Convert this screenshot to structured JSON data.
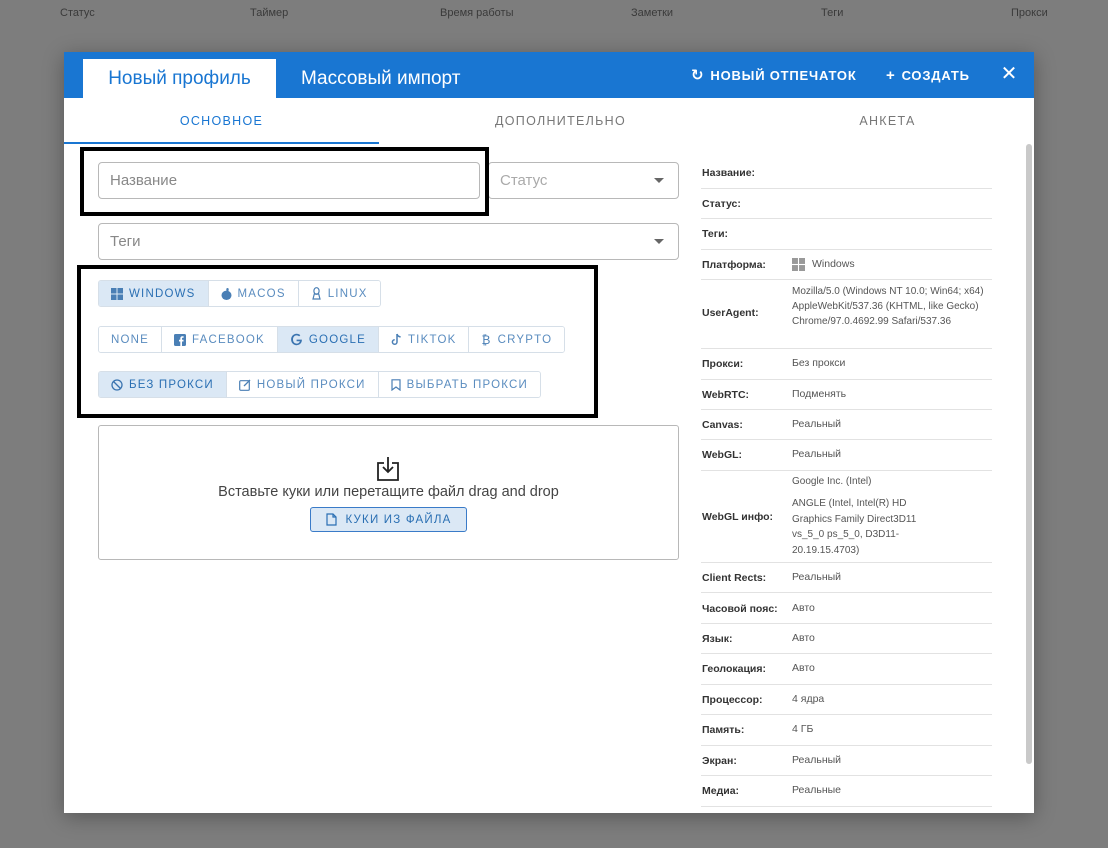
{
  "background_header": [
    "Статус",
    "Таймер",
    "Время работы",
    "Заметки",
    "Теги",
    "Прокси"
  ],
  "dialog": {
    "tabs": {
      "new_profile": "Новый профиль",
      "mass_import": "Массовый импорт"
    },
    "actions": {
      "new_fingerprint": "НОВЫЙ ОТПЕЧАТОК",
      "create": "СОЗДАТЬ"
    },
    "subtabs": {
      "main": "ОСНОВНОЕ",
      "extra": "ДОПОЛНИТЕЛЬНО",
      "form": "АНКЕТА"
    }
  },
  "form": {
    "name_placeholder": "Название",
    "status_placeholder": "Статус",
    "tags_placeholder": "Теги",
    "os_buttons": [
      "WINDOWS",
      "MACOS",
      "LINUX"
    ],
    "preset_buttons": [
      "NONE",
      "FACEBOOK",
      "GOOGLE",
      "TIKTOK",
      "CRYPTO"
    ],
    "proxy_buttons": [
      "БЕЗ ПРОКСИ",
      "НОВЫЙ ПРОКСИ",
      "ВЫБРАТЬ ПРОКСИ"
    ],
    "cookies": {
      "hint": "Вставьте куки или перетащите файл drag and drop",
      "button": "КУКИ ИЗ ФАЙЛА"
    }
  },
  "summary": {
    "name_label": "Название:",
    "status_label": "Статус:",
    "tags_label": "Теги:",
    "platform_label": "Платформа:",
    "platform_value": "Windows",
    "useragent_label": "UserAgent:",
    "useragent_value": "Mozilla/5.0 (Windows NT 10.0; Win64; x64) AppleWebKit/537.36 (KHTML, like Gecko) Chrome/97.0.4692.99 Safari/537.36",
    "proxy_label": "Прокси:",
    "proxy_value": "Без прокси",
    "webrtc_label": "WebRTC:",
    "webrtc_value": "Подменять",
    "canvas_label": "Canvas:",
    "canvas_value": "Реальный",
    "webgl_label": "WebGL:",
    "webgl_value": "Реальный",
    "webgl_info_label": "WebGL инфо:",
    "webgl_info_vendor": "Google Inc. (Intel)",
    "webgl_info_renderer": "ANGLE (Intel, Intel(R) HD Graphics Family Direct3D11 vs_5_0 ps_5_0, D3D11-20.19.15.4703)",
    "client_rects_label": "Client Rects:",
    "client_rects_value": "Реальный",
    "timezone_label": "Часовой пояс:",
    "timezone_value": "Авто",
    "language_label": "Язык:",
    "language_value": "Авто",
    "geo_label": "Геолокация:",
    "geo_value": "Авто",
    "cpu_label": "Процессор:",
    "cpu_value": "4 ядра",
    "memory_label": "Память:",
    "memory_value": "4 ГБ",
    "screen_label": "Экран:",
    "screen_value": "Реальный",
    "media_label": "Медиа:",
    "media_value": "Реальные"
  },
  "colors": {
    "accent": "#1976d2",
    "selected_bg": "#dbe8f5",
    "highlight_border": "#000000"
  }
}
